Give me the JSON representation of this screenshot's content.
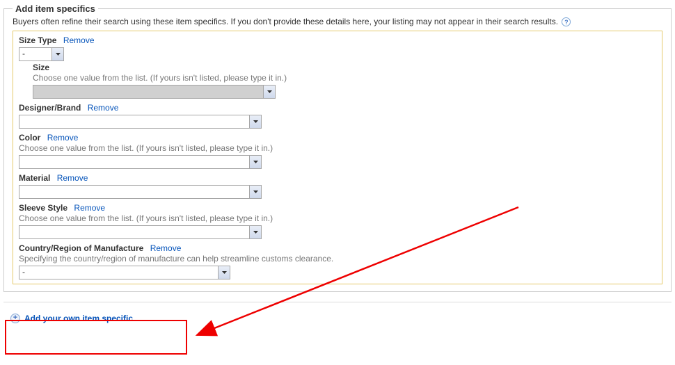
{
  "panel": {
    "legend": "Add item specifics",
    "description": "Buyers often refine their search using these item specifics. If you don't provide these details here, your listing may not appear in their search results."
  },
  "remove_label": "Remove",
  "hint_choose": "Choose one value from the list. (If yours isn't listed, please type it in.)",
  "fields": {
    "size_type": {
      "label": "Size Type",
      "value": "-"
    },
    "size": {
      "label": "Size"
    },
    "designer_brand": {
      "label": "Designer/Brand"
    },
    "color": {
      "label": "Color"
    },
    "material": {
      "label": "Material"
    },
    "sleeve_style": {
      "label": "Sleeve Style"
    },
    "country": {
      "label": "Country/Region of Manufacture",
      "hint": "Specifying the country/region of manufacture can help streamline customs clearance.",
      "value": "-"
    }
  },
  "add_link": "Add your own item specific"
}
